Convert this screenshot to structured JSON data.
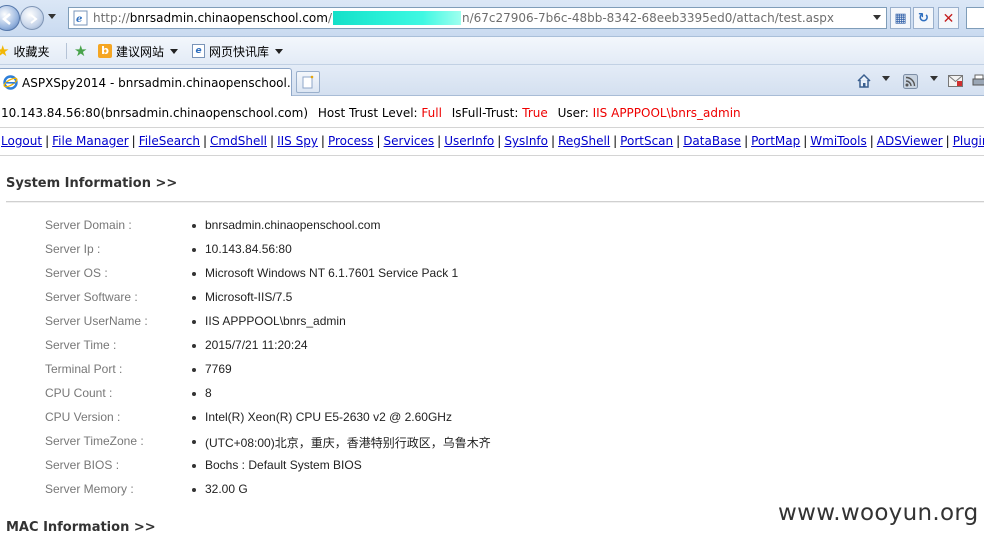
{
  "browser": {
    "url_prefix": "http://",
    "url_host": "bnrsadmin.chinaopenschool.com",
    "url_pre_redact": "/",
    "url_post_redact": "n/67c27906-7b6c-48bb-8342-68eeb3395ed0/attach/test.aspx",
    "favorites": {
      "favorites_label": "收藏夹",
      "suggested_sites": "建议网站",
      "web_slice_gallery": "网页快讯库"
    },
    "tab_title": "ASPXSpy2014 - bnrsadmin.chinaopenschool...."
  },
  "host_info": {
    "host": "10.143.84.56:80(bnrsadmin.chinaopenschool.com)",
    "trust_label": "Host Trust Level:",
    "trust_value": "Full",
    "fulltrust_label": "IsFull-Trust:",
    "fulltrust_value": "True",
    "user_label": "User:",
    "user_value": "IIS APPPOOL\\bnrs_admin"
  },
  "menu": [
    "Logout",
    "File Manager",
    "FileSearch",
    "CmdShell",
    "IIS Spy",
    "Process",
    "Services",
    "UserInfo",
    "SysInfo",
    "RegShell",
    "PortScan",
    "DataBase",
    "PortMap",
    "WmiTools",
    "ADSViewer",
    "PluginLoader"
  ],
  "system_info": {
    "title": "System Information >>",
    "rows": [
      {
        "label": "Server Domain :",
        "value": "bnrsadmin.chinaopenschool.com"
      },
      {
        "label": "Server Ip :",
        "value": "10.143.84.56:80"
      },
      {
        "label": "Server OS :",
        "value": "Microsoft Windows NT 6.1.7601 Service Pack 1"
      },
      {
        "label": "Server Software :",
        "value": "Microsoft-IIS/7.5"
      },
      {
        "label": "Server UserName :",
        "value": "IIS APPPOOL\\bnrs_admin"
      },
      {
        "label": "Server Time :",
        "value": "2015/7/21 11:20:24"
      },
      {
        "label": "Terminal Port :",
        "value": "7769"
      },
      {
        "label": "CPU Count :",
        "value": "8"
      },
      {
        "label": "CPU Version :",
        "value": "Intel(R) Xeon(R) CPU E5-2630 v2 @ 2.60GHz"
      },
      {
        "label": "Server TimeZone :",
        "value": "(UTC+08:00)北京，重庆，香港特别行政区，乌鲁木齐"
      },
      {
        "label": "Server BIOS :",
        "value": "Bochs : Default System BIOS"
      },
      {
        "label": "Server Memory :",
        "value": "32.00 G"
      }
    ]
  },
  "mac_info": {
    "title": "MAC Information >>"
  },
  "watermark": "www.wooyun.org",
  "colors": {
    "link": "#0000cc",
    "highlight_red": "#ee0000",
    "label_gray": "#777777",
    "redaction_cyan": "#2af0d8"
  }
}
